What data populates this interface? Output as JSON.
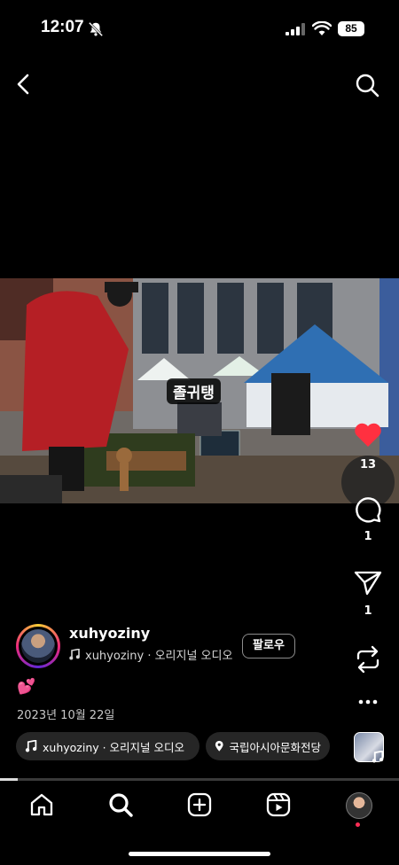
{
  "status_bar": {
    "time": "12:07",
    "battery": "85"
  },
  "video": {
    "caption": "졸귀탱",
    "progress": 0.045
  },
  "actions": {
    "like_count": "13",
    "comment_count": "1",
    "share_count": "1"
  },
  "author": {
    "username": "xuhyoziny",
    "audio_line": "xuhyoziny · 오리지널 오디오",
    "follow_label": "팔로우"
  },
  "post": {
    "emoji": "💕",
    "date": "2023년 10월 22일",
    "audio_pill": "xuhyoziny · 오리지널 오디오",
    "location_pill": "국립아시아문화전당"
  },
  "icons": {
    "back": "chevron-left-icon",
    "search": "search-icon",
    "heart": "heart-icon",
    "comment": "comment-icon",
    "share": "paper-plane-icon",
    "remix": "repost-icon",
    "more": "more-icon",
    "home": "home-icon",
    "explore": "search-icon",
    "create": "plus-square-icon",
    "reels": "reels-icon",
    "music": "music-note-icon",
    "location": "location-pin-icon"
  },
  "colors": {
    "like": "#ff3040",
    "background": "#000000",
    "pill": "#262626"
  }
}
